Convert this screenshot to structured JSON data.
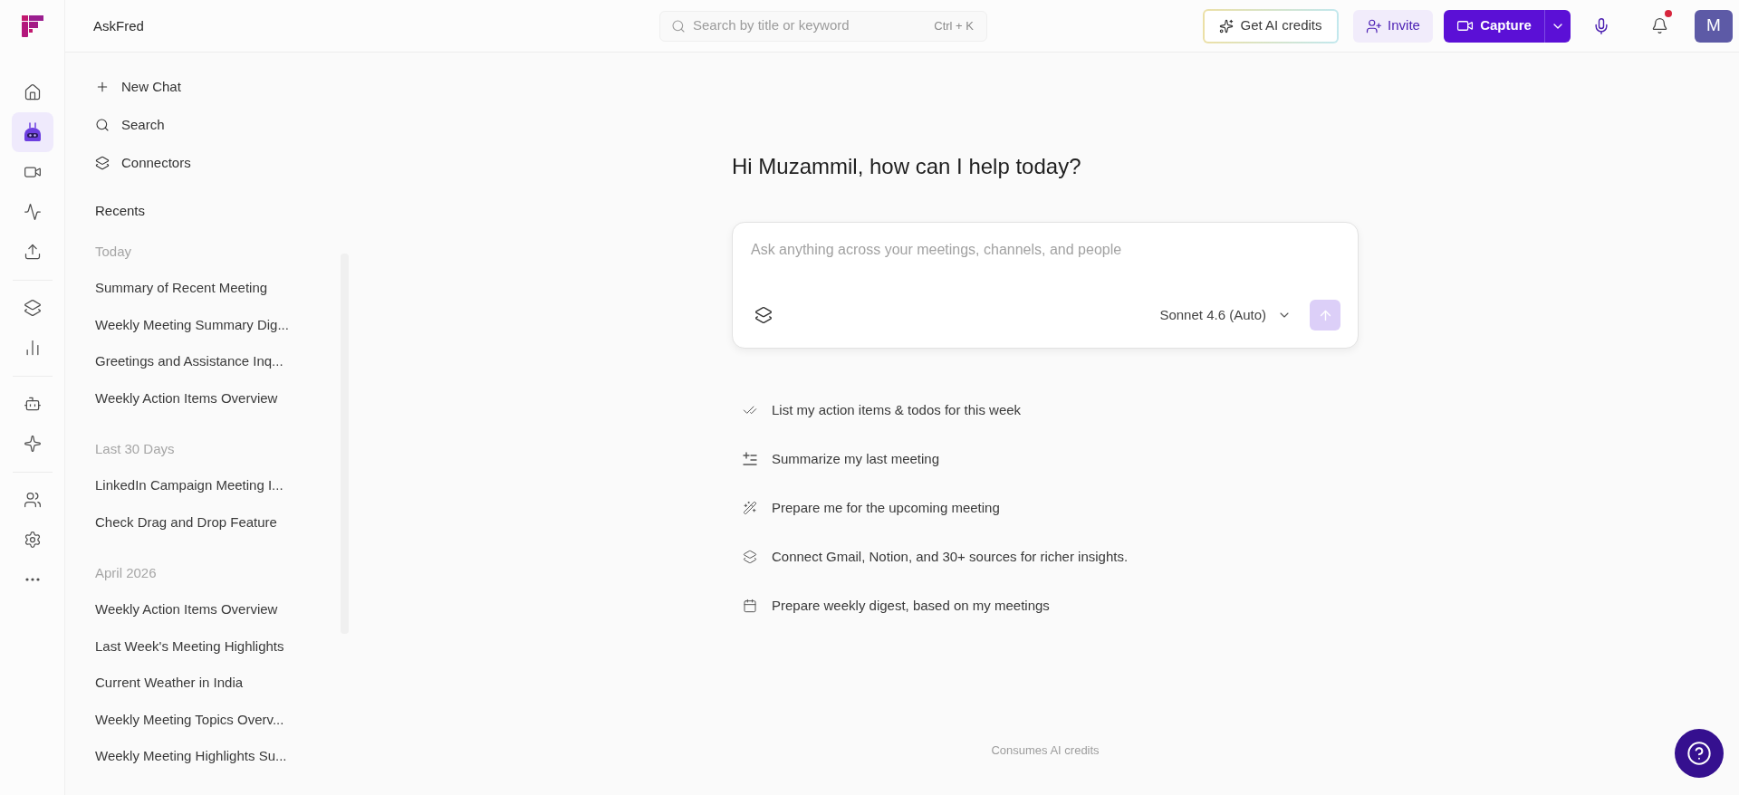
{
  "rail": {
    "groups": [
      {
        "items": [
          {
            "selected": false
          },
          {
            "selected": true
          },
          {
            "selected": false
          },
          {
            "selected": false
          },
          {
            "selected": false
          }
        ]
      },
      {
        "items": [
          {
            "selected": false
          },
          {
            "selected": false
          }
        ]
      },
      {
        "items": [
          {
            "selected": false
          },
          {
            "selected": false
          }
        ]
      },
      {
        "items": [
          {
            "selected": false
          },
          {
            "selected": false
          },
          {
            "selected": false
          }
        ]
      }
    ]
  },
  "top_bar": {
    "title": "AskFred",
    "search": {
      "placeholder": "Search by title or keyword",
      "shortcut": "Ctrl + K"
    },
    "credits_button": "Get AI credits",
    "invite_button": "Invite",
    "capture_button": "Capture",
    "notifications": {
      "unread": true
    },
    "avatar": {
      "initial": "M"
    }
  },
  "sidebar": {
    "actions": [
      {
        "label": "New Chat"
      },
      {
        "label": "Search"
      },
      {
        "label": "Connectors"
      }
    ],
    "recents": {
      "title": "Recents",
      "sections": [
        {
          "title": "Today",
          "items": [
            "Summary of Recent Meeting",
            "Weekly Meeting Summary Dig...",
            "Greetings and Assistance Inq...",
            "Weekly Action Items Overview"
          ]
        },
        {
          "title": "Last 30 Days",
          "items": [
            "LinkedIn Campaign Meeting I...",
            "Check Drag and Drop Feature"
          ]
        },
        {
          "title": "April 2026",
          "items": [
            "Weekly Action Items Overview",
            "Last Week's Meeting Highlights",
            "Current Weather in India",
            "Weekly Meeting Topics Overv...",
            "Weekly Meeting Highlights Su..."
          ]
        }
      ]
    }
  },
  "main": {
    "greeting": "Hi Muzammil, how can I help today?",
    "composer": {
      "placeholder": "Ask anything across your meetings, channels, and people",
      "model": "Sonnet 4.6 (Auto)",
      "send": {
        "disabled": true
      }
    },
    "suggestions": [
      {
        "text": "List my action items & todos for this week"
      },
      {
        "text": "Summarize my last meeting"
      },
      {
        "text": "Prepare me for the upcoming meeting"
      },
      {
        "text": "Connect Gmail, Notion, and 30+ sources for richer insights."
      },
      {
        "text": "Prepare weekly digest, based on my meetings"
      }
    ],
    "footer_note": "Consumes AI credits"
  }
}
